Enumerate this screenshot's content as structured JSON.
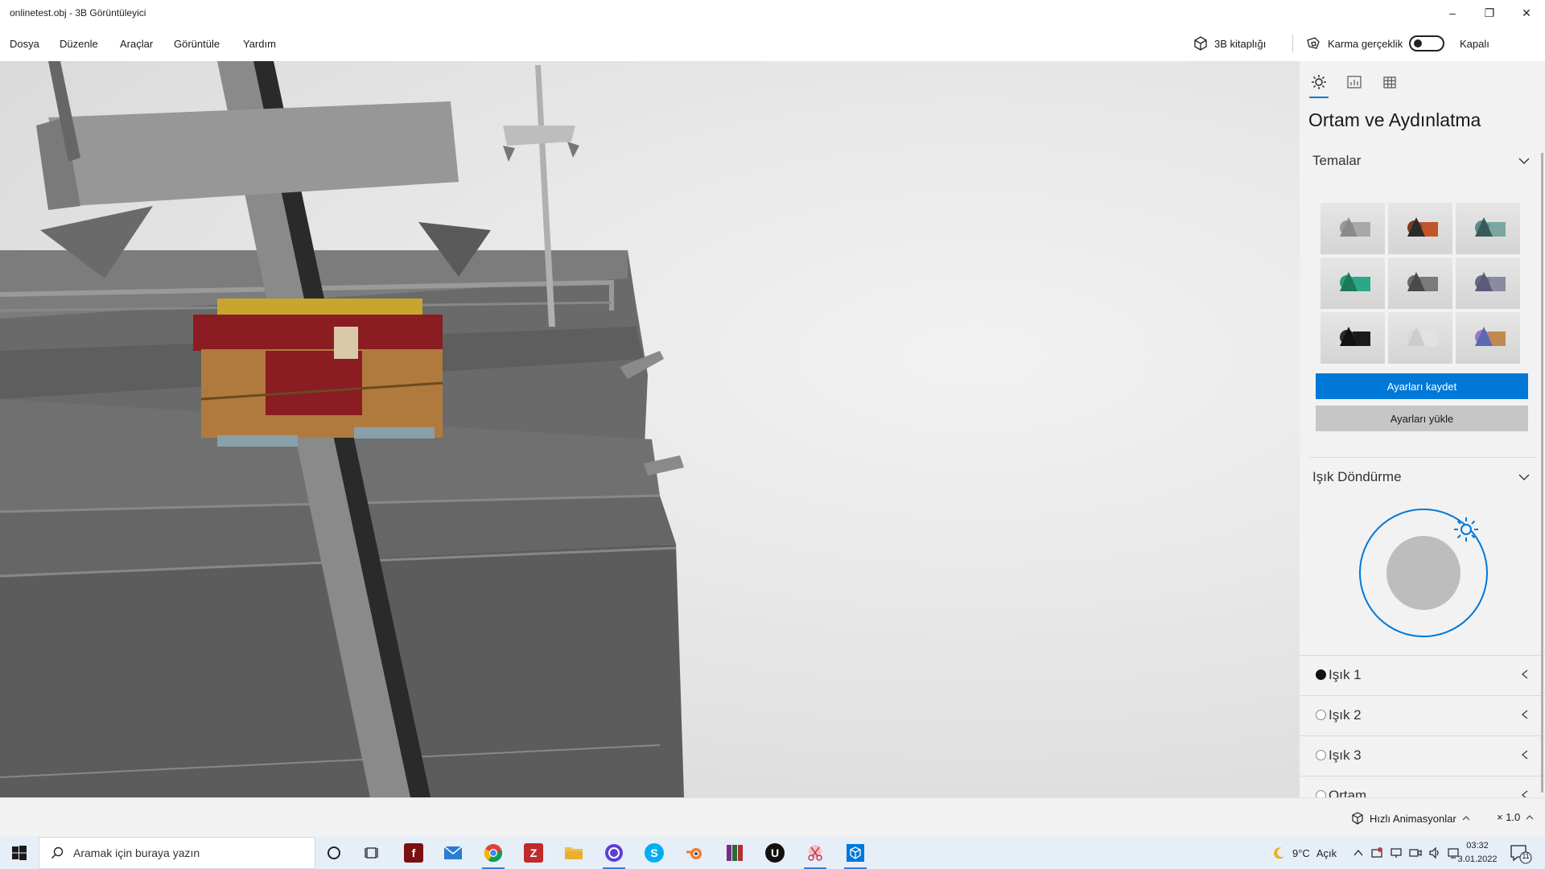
{
  "window": {
    "title": "onlinetest.obj - 3B Görüntüleyici",
    "minimize": "–",
    "maximize": "❐",
    "close": "✕"
  },
  "menu": {
    "items": [
      "Dosya",
      "Düzenle",
      "Araçlar",
      "Görüntüle",
      "Yardım"
    ],
    "library_label": "3B kitaplığı",
    "mixed_reality_label": "Karma gerçeklik",
    "toggle_state": "Kapalı"
  },
  "panel": {
    "title": "Ortam ve Aydınlatma",
    "themes_label": "Temalar",
    "themes": [
      {
        "ball": "#9a9a9a",
        "cone": "#8a8a8a",
        "box": "#a8a8a8"
      },
      {
        "ball": "#7a3a2a",
        "cone": "#2a2a2a",
        "box": "#c0552a"
      },
      {
        "ball": "#5a8a8a",
        "cone": "#3a5a5a",
        "box": "#7aa8a0"
      },
      {
        "ball": "#2a9a7a",
        "cone": "#1a7a5a",
        "box": "#2aa888"
      },
      {
        "ball": "#6a6a6a",
        "cone": "#4a4a4a",
        "box": "#7a7a7a"
      },
      {
        "ball": "#6a6a7a",
        "cone": "#5a5a7a",
        "box": "#8a8aa0"
      },
      {
        "ball": "#2a2a2a",
        "cone": "#111111",
        "box": "#1a1a1a"
      },
      {
        "ball": "#d8d8d8",
        "cone": "#cccccc",
        "box": "#e2e2e2"
      },
      {
        "ball": "#9a7ac0",
        "cone": "#5a6ab0",
        "box": "#c08a50"
      }
    ],
    "save_label": "Ayarları kaydet",
    "load_label": "Ayarları yükle",
    "rotation_label": "Işık Döndürme",
    "lights": [
      {
        "label": "Işık 1",
        "selected": true
      },
      {
        "label": "Işık 2",
        "selected": false
      },
      {
        "label": "Işık 3",
        "selected": false
      },
      {
        "label": "Ortam",
        "selected": false
      }
    ]
  },
  "status": {
    "animations_label": "Hızlı Animasyonlar",
    "speed": "× 1.0"
  },
  "taskbar": {
    "search_placeholder": "Aramak için buraya yazın",
    "weather_temp": "9°C",
    "weather_text": "Açık",
    "time": "03:32",
    "date": "3.01.2022",
    "notification_count": "11"
  },
  "colors": {
    "accent": "#0078d7",
    "panel_bg": "#f2f2f2"
  }
}
